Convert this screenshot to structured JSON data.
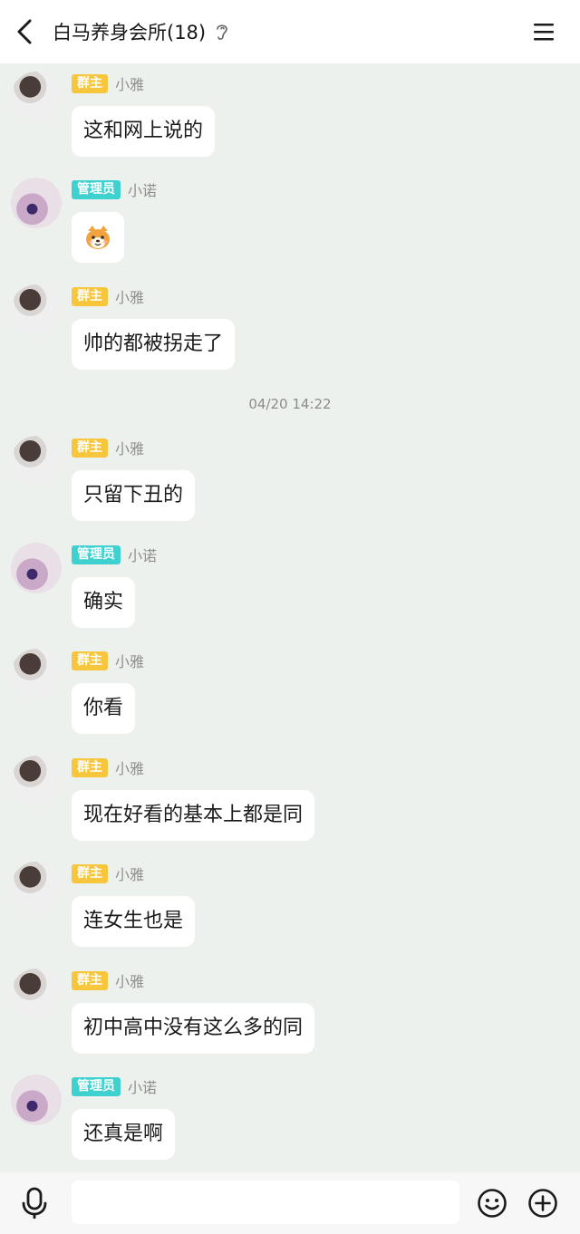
{
  "header": {
    "title": "白马养身会所(18)"
  },
  "timestamp": "04/20 14:22",
  "messages": [
    {
      "role": "群主",
      "name": "小雅",
      "text": "这和网上说的"
    },
    {
      "role": "管理员",
      "name": "小诺",
      "text": "",
      "emoji": "shiba-dog-emoji"
    },
    {
      "role": "群主",
      "name": "小雅",
      "text": "帅的都被拐走了"
    },
    {
      "role": "群主",
      "name": "小雅",
      "text": "只留下丑的"
    },
    {
      "role": "管理员",
      "name": "小诺",
      "text": "确实"
    },
    {
      "role": "群主",
      "name": "小雅",
      "text": "你看"
    },
    {
      "role": "群主",
      "name": "小雅",
      "text": "现在好看的基本上都是同"
    },
    {
      "role": "群主",
      "name": "小雅",
      "text": "连女生也是"
    },
    {
      "role": "群主",
      "name": "小雅",
      "text": "初中高中没有这么多的同"
    },
    {
      "role": "管理员",
      "name": "小诺",
      "text": "还真是啊"
    }
  ],
  "input": {
    "placeholder": ""
  },
  "colors": {
    "background": "#edf1ed",
    "owner_badge": "#f7c63d",
    "admin_badge": "#3ed1cf"
  },
  "icons": [
    "back-arrow-icon",
    "ear-icon",
    "menu-icon",
    "microphone-icon",
    "smiley-icon",
    "plus-circle-icon"
  ]
}
